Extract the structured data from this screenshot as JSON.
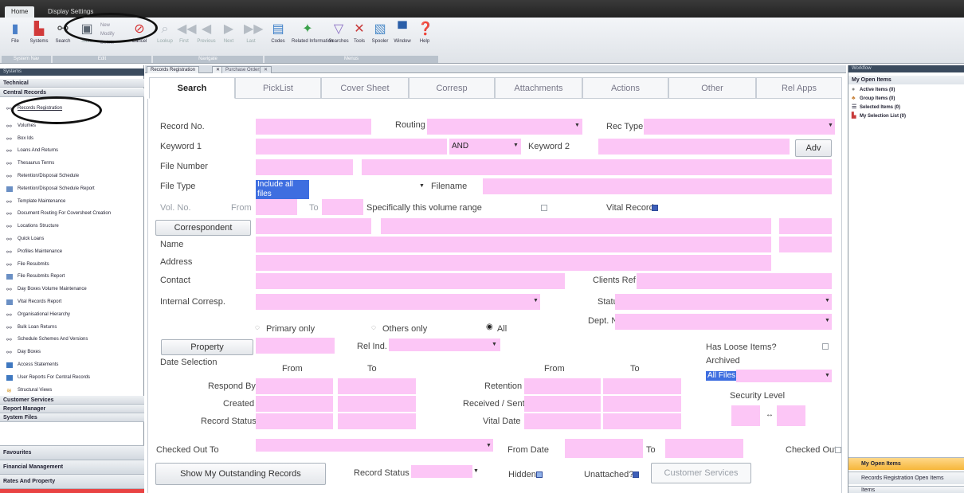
{
  "topbar": {
    "tabs": [
      "Home",
      "Display Settings"
    ]
  },
  "ribbon": {
    "buttons": [
      "File",
      "Systems",
      "Search",
      "Save",
      "Delete",
      "Cancel",
      "Lookup",
      "First",
      "Previous",
      "Next",
      "Last",
      "Codes",
      "Related Information",
      "Searches",
      "Tools",
      "Spooler",
      "Window",
      "Help"
    ],
    "small_buttons": [
      "New",
      "Modify",
      "Delete"
    ],
    "groups": [
      "System Nav",
      "Edit",
      "Navigate",
      "Menus"
    ]
  },
  "left_panel": {
    "header": "Systems",
    "sections": [
      "Technical",
      "Central Records"
    ],
    "items": [
      "Records Registration",
      "Volumes",
      "Box Ids",
      "Loans And Returns",
      "Thesaurus Terms",
      "Retention/Disposal Schedule",
      "Retention/Disposal Schedule Report",
      "Template Maintenance",
      "Document Routing For Coversheet Creation",
      "Locations Structure",
      "Quick Loans",
      "Profiles Maintenance",
      "File Resubmits",
      "File Resubmits Report",
      "Day Boxes Volume Maintenance",
      "Vital Records Report",
      "Organisational Hierarchy",
      "Bulk Loan Returns",
      "Schedule Schemes And Versions",
      "Day Boxes",
      "Access Statements",
      "User Reports For Central Records",
      "Structural Views"
    ],
    "lower_sections": [
      "Customer Services",
      "Report Manager",
      "System Files"
    ],
    "bottom_sections": [
      "Favourites",
      "Financial Management",
      "Rates And Property",
      "Technical"
    ]
  },
  "doc_tabs": [
    "Records Registration",
    "Purchase Orders"
  ],
  "inner_tabs": [
    "Search",
    "PickList",
    "Cover Sheet",
    "Corresp",
    "Attachments",
    "Actions",
    "Other",
    "Rel Apps"
  ],
  "form": {
    "record_no": "Record No.",
    "routing": "Routing",
    "rec_type": "Rec Type",
    "keyword1": "Keyword 1",
    "and_value": "AND",
    "keyword2": "Keyword 2",
    "adv": "Adv",
    "file_number": "File Number",
    "file_type": "File Type",
    "file_type_value": "Include all files",
    "filename": "Filename",
    "vol_no": "Vol. No.",
    "from": "From",
    "to": "To",
    "vol_range": "Specifically this volume range",
    "vital_record": "Vital Record",
    "correspondent": "Correspondent",
    "name": "Name",
    "address": "Address",
    "contact": "Contact",
    "clients_ref": "Clients Ref",
    "internal_corresp": "Internal Corresp.",
    "status": "Status",
    "dept_name": "Dept. Name",
    "primary_only": "Primary only",
    "others_only": "Others only",
    "all": "All",
    "property": "Property",
    "rel_ind": "Rel Ind.",
    "has_loose": "Has Loose Items?",
    "archived": "Archived",
    "archived_value": "All Files",
    "date_selection": "Date Selection",
    "from_head": "From",
    "to_head": "To",
    "respond_by": "Respond By",
    "created": "Created",
    "record_status": "Record Status",
    "retention": "Retention",
    "received_sent": "Received / Sent",
    "vital_date": "Vital Date",
    "security_level": "Security Level",
    "security_arrow": "↔",
    "checked_out_to": "Checked Out To",
    "from_date": "From Date",
    "to_short": "To",
    "checked_out": "Checked Out",
    "show_outstanding": "Show My Outstanding Records",
    "record_status2": "Record Status",
    "hidden": "Hidden",
    "unattached": "Unattached?",
    "customer_services": "Customer Services"
  },
  "right_panel": {
    "header": "Workflow",
    "title": "My Open Items",
    "items": [
      "Active Items (0)",
      "Group Items (0)",
      "Selected Items (0)",
      "My Selection List (0)"
    ],
    "bottom": [
      "My Open Items",
      "Records Registration Open Items",
      "Items"
    ]
  }
}
